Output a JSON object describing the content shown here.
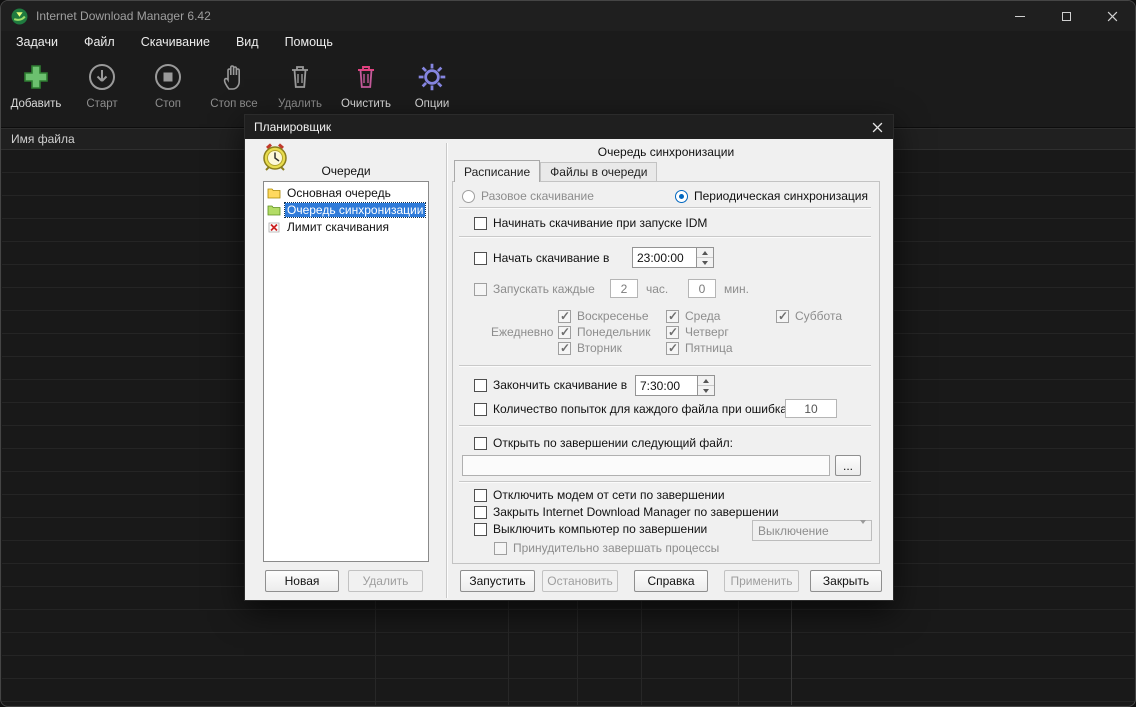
{
  "window": {
    "title": "Internet Download Manager 6.42",
    "menu": [
      {
        "label": "Задачи"
      },
      {
        "label": "Файл"
      },
      {
        "label": "Скачивание"
      },
      {
        "label": "Вид"
      },
      {
        "label": "Помощь"
      }
    ],
    "toolbar": [
      {
        "label": "Добавить"
      },
      {
        "label": "Старт"
      },
      {
        "label": "Стоп"
      },
      {
        "label": "Стоп все"
      },
      {
        "label": "Удалить"
      },
      {
        "label": "Очистить"
      },
      {
        "label": "Опции"
      }
    ],
    "table": {
      "columns": [
        {
          "label": "Имя файла"
        }
      ]
    }
  },
  "dialog": {
    "title": "Планировщик",
    "left": {
      "queues_label": "Очереди",
      "queues": [
        {
          "label": "Основная очередь"
        },
        {
          "label": "Очередь синхронизации"
        },
        {
          "label": "Лимит скачивания"
        }
      ],
      "new_button": "Новая",
      "delete_button": "Удалить"
    },
    "header": "Очередь синхронизации",
    "tabs": [
      {
        "label": "Расписание"
      },
      {
        "label": "Файлы в очереди"
      }
    ],
    "schedule": {
      "one_time_label": "Разовое скачивание",
      "periodic_label": "Периодическая синхронизация",
      "start_on_idm_label": "Начинать скачивание при запуске IDM",
      "start_at_label": "Начать скачивание в",
      "start_time": "23:00:00",
      "run_every_label": "Запускать каждые",
      "hours_value": "2",
      "hours_unit": "час.",
      "minutes_value": "0",
      "minutes_unit": "мин.",
      "daily_label": "Ежедневно",
      "days": [
        {
          "label": "Воскресенье"
        },
        {
          "label": "Понедельник"
        },
        {
          "label": "Вторник"
        },
        {
          "label": "Среда"
        },
        {
          "label": "Четверг"
        },
        {
          "label": "Пятница"
        },
        {
          "label": "Суббота"
        }
      ],
      "stop_at_label": "Закончить скачивание в",
      "stop_time": "7:30:00",
      "retries_label": "Количество попыток для каждого файла при ошибках:",
      "retries_value": "10",
      "open_file_label": "Открыть по завершении следующий файл:",
      "open_file_value": "",
      "browse_button": "...",
      "hangup_label": "Отключить модем от сети по завершении",
      "close_idm_label": "Закрыть Internet Download Manager по завершении",
      "shutdown_label": "Выключить компьютер по завершении",
      "shutdown_mode": "Выключение",
      "force_close_label": "Принудительно завершать процессы"
    },
    "buttons": {
      "start": "Запустить",
      "stop": "Остановить",
      "help": "Справка",
      "apply": "Применить",
      "close": "Закрыть"
    }
  }
}
